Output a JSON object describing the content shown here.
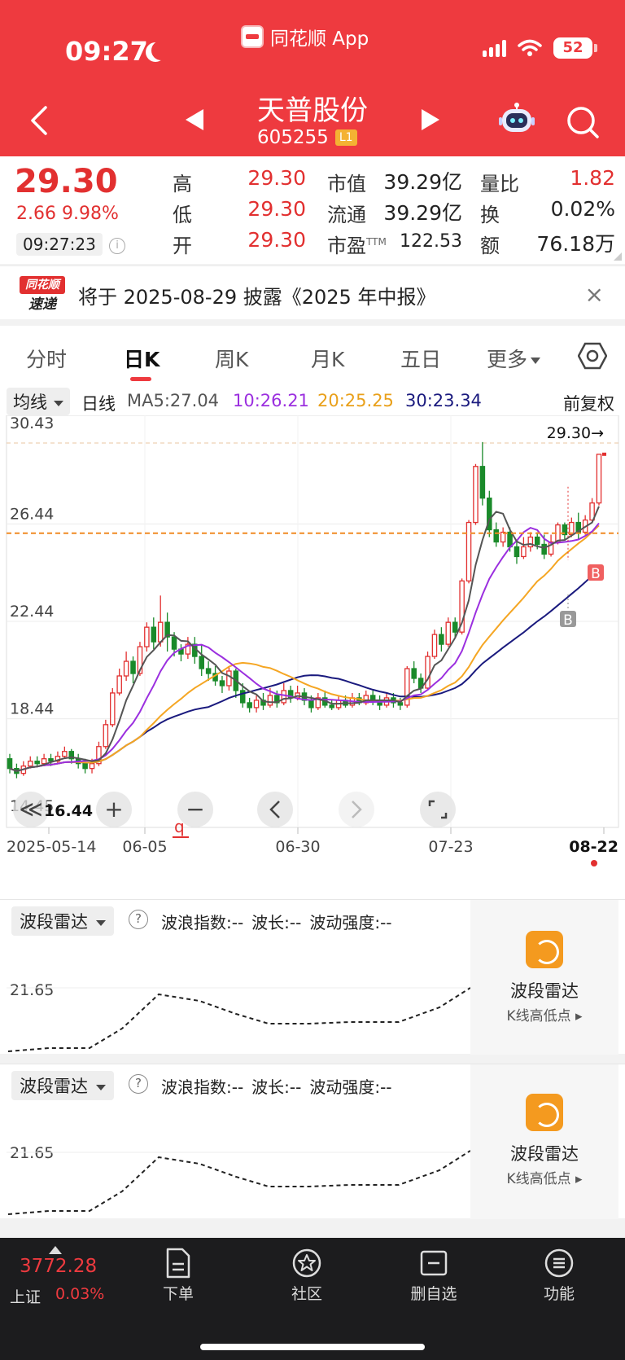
{
  "status": {
    "time": "09:27",
    "app_name": "同花顺 App",
    "battery": "52"
  },
  "header": {
    "name": "天普股份",
    "code": "605255",
    "level": "L1"
  },
  "quote": {
    "price": "29.30",
    "change": "2.66  9.98%",
    "time": "09:27:23",
    "info_mark": "i",
    "high_label": "高",
    "high": "29.30",
    "low_label": "低",
    "low": "29.30",
    "open_label": "开",
    "open": "29.30",
    "mcap_label": "市值",
    "mcap": "39.29亿",
    "float_label": "流通",
    "float": "39.29亿",
    "pe_label": "市盈",
    "pe_sup": "TTM",
    "pe": "122.53",
    "vr_label": "量比",
    "vr": "1.82",
    "turnover_label": "换",
    "turnover": "0.02%",
    "amount_label": "额",
    "amount": "76.18万"
  },
  "notice": {
    "logo_top": "同花顺",
    "logo_bottom": "速递",
    "text": "将于 2025-08-29 披露《2025 年中报》",
    "close": "×"
  },
  "tabs": [
    "分时",
    "日K",
    "周K",
    "月K",
    "五日",
    "更多"
  ],
  "ma": {
    "dropdown": "均线",
    "period": "日线",
    "ma5": "MA5:27.04",
    "ma10": "10:26.21",
    "ma20": "20:25.25",
    "ma30": "30:23.34",
    "adjust": "前复权",
    "colors": {
      "ma5": "#555555",
      "ma10": "#9b2fdf",
      "ma20": "#f5a623",
      "ma30": "#1a1a7e"
    }
  },
  "chart": {
    "y_labels": [
      "30.43",
      "26.44",
      "22.44",
      "18.44",
      "14.45"
    ],
    "x_labels": [
      "2025-05-14",
      "06-05",
      "06-30",
      "07-23",
      "08-22"
    ],
    "last_label": "29.30→",
    "low_label": "16.44",
    "marker_b": "B",
    "marker_q": "q",
    "colors": {
      "up": "#e23030",
      "down": "#1a8a2a",
      "ref_line": "#f08a24"
    }
  },
  "chart_data": {
    "type": "candlestick",
    "ylim": [
      14.45,
      30.43
    ],
    "x": [
      "2025-05-14",
      "06-05",
      "06-30",
      "07-23",
      "08-22"
    ],
    "candles": [
      [
        16.8,
        16.4,
        17.0,
        16.2
      ],
      [
        16.4,
        16.2,
        16.6,
        16.0
      ],
      [
        16.2,
        16.5,
        16.7,
        16.1
      ],
      [
        16.5,
        16.7,
        16.9,
        16.4
      ],
      [
        16.7,
        16.6,
        16.9,
        16.5
      ],
      [
        16.6,
        16.8,
        17.0,
        16.5
      ],
      [
        16.8,
        16.7,
        17.0,
        16.5
      ],
      [
        16.7,
        16.9,
        17.1,
        16.6
      ],
      [
        16.9,
        17.1,
        17.3,
        16.8
      ],
      [
        17.1,
        16.8,
        17.2,
        16.6
      ],
      [
        16.8,
        16.6,
        17.0,
        16.4
      ],
      [
        16.6,
        16.4,
        16.8,
        16.2
      ],
      [
        16.4,
        16.6,
        16.8,
        16.2
      ],
      [
        16.6,
        17.3,
        17.5,
        16.5
      ],
      [
        17.3,
        18.2,
        18.4,
        17.2
      ],
      [
        18.2,
        19.5,
        19.7,
        18.1
      ],
      [
        19.5,
        20.2,
        20.5,
        19.4
      ],
      [
        20.2,
        20.8,
        21.2,
        20.0
      ],
      [
        20.8,
        20.3,
        21.0,
        19.9
      ],
      [
        20.3,
        21.4,
        21.6,
        20.2
      ],
      [
        21.4,
        22.2,
        22.4,
        21.2
      ],
      [
        22.2,
        21.6,
        22.6,
        21.3
      ],
      [
        21.6,
        22.4,
        23.5,
        21.4
      ],
      [
        22.4,
        21.8,
        22.8,
        21.2
      ],
      [
        21.8,
        21.3,
        22.0,
        21.0
      ],
      [
        21.3,
        21.1,
        21.5,
        20.8
      ],
      [
        21.1,
        21.5,
        21.8,
        20.9
      ],
      [
        21.5,
        21.0,
        21.8,
        20.7
      ],
      [
        21.0,
        20.5,
        21.5,
        20.2
      ],
      [
        20.5,
        20.3,
        20.8,
        20.0
      ],
      [
        20.3,
        20.0,
        20.6,
        19.8
      ],
      [
        20.0,
        19.8,
        20.2,
        19.5
      ],
      [
        19.8,
        20.4,
        20.6,
        19.6
      ],
      [
        20.4,
        19.6,
        20.5,
        19.3
      ],
      [
        19.6,
        19.1,
        19.9,
        18.9
      ],
      [
        19.1,
        18.9,
        19.3,
        18.7
      ],
      [
        18.9,
        19.2,
        19.4,
        18.7
      ],
      [
        19.2,
        19.0,
        19.5,
        18.8
      ],
      [
        19.0,
        19.4,
        19.7,
        18.9
      ],
      [
        19.4,
        19.1,
        19.6,
        18.9
      ],
      [
        19.1,
        19.6,
        19.9,
        19.0
      ],
      [
        19.6,
        19.3,
        19.8,
        19.1
      ],
      [
        19.3,
        19.5,
        19.8,
        19.2
      ],
      [
        19.5,
        19.2,
        19.7,
        19.0
      ],
      [
        19.2,
        18.9,
        19.4,
        18.7
      ],
      [
        18.9,
        19.3,
        19.5,
        18.8
      ],
      [
        19.3,
        19.0,
        19.6,
        18.9
      ],
      [
        19.0,
        18.9,
        19.2,
        18.8
      ],
      [
        18.9,
        19.2,
        19.4,
        18.8
      ],
      [
        19.2,
        19.0,
        19.4,
        18.9
      ],
      [
        19.0,
        19.3,
        19.5,
        18.9
      ],
      [
        19.3,
        19.1,
        19.5,
        19.0
      ],
      [
        19.1,
        19.4,
        19.6,
        19.0
      ],
      [
        19.4,
        19.2,
        19.6,
        19.0
      ],
      [
        19.2,
        19.0,
        19.4,
        18.8
      ],
      [
        19.0,
        19.3,
        19.5,
        18.9
      ],
      [
        19.3,
        19.1,
        19.5,
        18.9
      ],
      [
        19.1,
        19.0,
        19.3,
        18.8
      ],
      [
        19.0,
        20.5,
        20.6,
        18.9
      ],
      [
        20.5,
        20.1,
        20.8,
        19.9
      ],
      [
        20.1,
        19.7,
        20.3,
        19.5
      ],
      [
        19.7,
        21.0,
        21.2,
        19.6
      ],
      [
        21.0,
        21.9,
        22.1,
        20.9
      ],
      [
        21.9,
        21.5,
        22.2,
        21.2
      ],
      [
        21.5,
        22.4,
        22.6,
        21.4
      ],
      [
        22.4,
        22.0,
        22.6,
        21.8
      ],
      [
        22.0,
        24.1,
        24.2,
        21.9
      ],
      [
        24.1,
        26.5,
        26.6,
        24.0
      ],
      [
        26.5,
        28.8,
        28.9,
        26.4
      ],
      [
        28.8,
        27.5,
        29.8,
        27.2
      ],
      [
        27.5,
        26.2,
        27.8,
        25.9
      ],
      [
        26.2,
        25.7,
        26.5,
        25.5
      ],
      [
        25.7,
        26.1,
        26.3,
        25.5
      ],
      [
        26.1,
        25.5,
        26.3,
        25.3
      ],
      [
        25.5,
        25.1,
        25.8,
        24.8
      ],
      [
        25.1,
        25.5,
        25.9,
        25.0
      ],
      [
        25.5,
        25.9,
        26.1,
        25.3
      ],
      [
        25.9,
        25.6,
        26.1,
        25.4
      ],
      [
        25.6,
        25.2,
        26.0,
        25.0
      ],
      [
        25.2,
        25.7,
        26.0,
        25.1
      ],
      [
        25.7,
        26.4,
        26.5,
        25.6
      ],
      [
        26.4,
        26.0,
        26.5,
        25.8
      ],
      [
        26.0,
        26.5,
        26.7,
        25.9
      ],
      [
        26.5,
        26.1,
        26.9,
        25.8
      ],
      [
        26.1,
        26.6,
        26.8,
        26.0
      ],
      [
        26.6,
        27.3,
        27.5,
        26.5
      ],
      [
        27.3,
        29.3,
        29.3,
        27.2
      ]
    ],
    "ma_series": {
      "ma5_last": 27.04,
      "ma10_last": 26.21,
      "ma20_last": 25.25,
      "ma30_last": 23.34
    },
    "ref_line": 26.06,
    "last": 29.3
  },
  "controls": {
    "collapse": "≪",
    "zoom_in": "+",
    "zoom_out": "−"
  },
  "radar1": {
    "dropdown": "波段雷达",
    "help": "?",
    "wave_index": "波浪指数:--",
    "wave_len": "波长:--",
    "wave_strength": "波动强度:--",
    "ylabel": "21.65",
    "promo_title": "波段雷达",
    "promo_sub": "K线高低点 ▸"
  },
  "radar2": {
    "dropdown": "波段雷达",
    "help": "?",
    "wave_index": "波浪指数:--",
    "wave_len": "波长:--",
    "wave_strength": "波动强度:--",
    "ylabel": "21.65",
    "promo_title": "波段雷达",
    "promo_sub": "K线高低点 ▸"
  },
  "bottom": {
    "index_value": "3772.28",
    "index_name": "上证",
    "index_pct": "0.03%",
    "nav": [
      "下单",
      "社区",
      "删自选",
      "功能"
    ]
  }
}
